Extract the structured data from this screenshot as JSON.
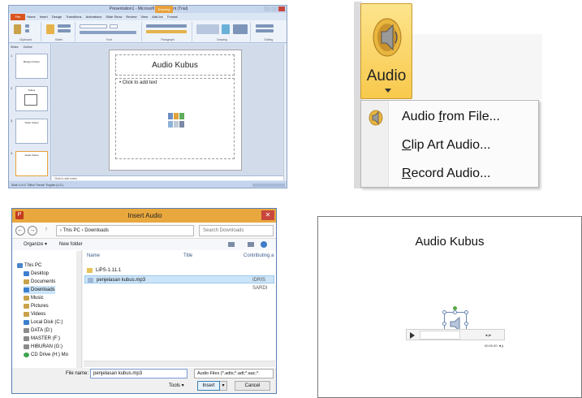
{
  "ppt": {
    "title": "Presentation1 - Microsoft PowerPoint (Trial)",
    "tool_badge": "Drawing Tools",
    "file_tab": "File",
    "tabs": [
      "Home",
      "Insert",
      "Design",
      "Transitions",
      "Animations",
      "Slide Show",
      "Review",
      "View",
      "Add-Ins",
      "Format"
    ],
    "ribbon_groups": [
      "Clipboard",
      "Slides",
      "Font",
      "Paragraph",
      "Drawing",
      "Editing"
    ],
    "thumb_tabs": [
      "Slides",
      "Outline"
    ],
    "thumbs": [
      {
        "num": "1",
        "text": "Bangun Kubus"
      },
      {
        "num": "2",
        "text": "Kubus"
      },
      {
        "num": "3",
        "text": "Video Kubus"
      },
      {
        "num": "4",
        "text": "Audio Kubus"
      }
    ],
    "slide_title": "Audio Kubus",
    "content_placeholder": "• Click to add text",
    "notes_placeholder": "Click to add notes",
    "status": "Slide 4 of 4   \"Office Theme\"   English (U.S.)"
  },
  "audio_menu": {
    "button_label": "Audio",
    "items": [
      {
        "pre": "Audio ",
        "key": "f",
        "post": "rom File..."
      },
      {
        "pre": "",
        "key": "C",
        "post": "lip Art Audio..."
      },
      {
        "pre": "",
        "key": "R",
        "post": "ecord Audio..."
      }
    ]
  },
  "dialog": {
    "title": "Insert Audio",
    "close": "✕",
    "path": "›  This PC  ›  Downloads",
    "search_placeholder": "Search Downloads",
    "organize": "Organize ▾",
    "new_folder": "New folder",
    "nav": [
      "This PC",
      "Desktop",
      "Documents",
      "Downloads",
      "Music",
      "Pictures",
      "Videos",
      "Local Disk (C:)",
      "DATA (D:)",
      "MASTER (F:)",
      "HIBURAN (G:)",
      "CD Drive (H:) Mo"
    ],
    "columns": {
      "name": "Name",
      "title": "Title",
      "contrib": "Contributing a"
    },
    "files": [
      {
        "name": "LiPS-1.11.1",
        "contrib": ""
      },
      {
        "name": "penjelasan kubus.mp3",
        "contrib": "IDRIS SARDI"
      }
    ],
    "file_name_label": "File name:",
    "file_name_value": "penjelasan kubus.mp3",
    "file_type": "Audio Files (*.adts;*.adt;*.aac;*.",
    "tools": "Tools  ▾",
    "insert": "Insert",
    "cancel": "Cancel"
  },
  "slide": {
    "title": "Audio Kubus",
    "time": "◄|►  00:00.00  ◄))"
  },
  "colors": {
    "ppt_orange": "#d9541e",
    "audio_gold": "#f8c94c",
    "dialog_title": "#e8a83e",
    "selection": "#cce4f7"
  }
}
